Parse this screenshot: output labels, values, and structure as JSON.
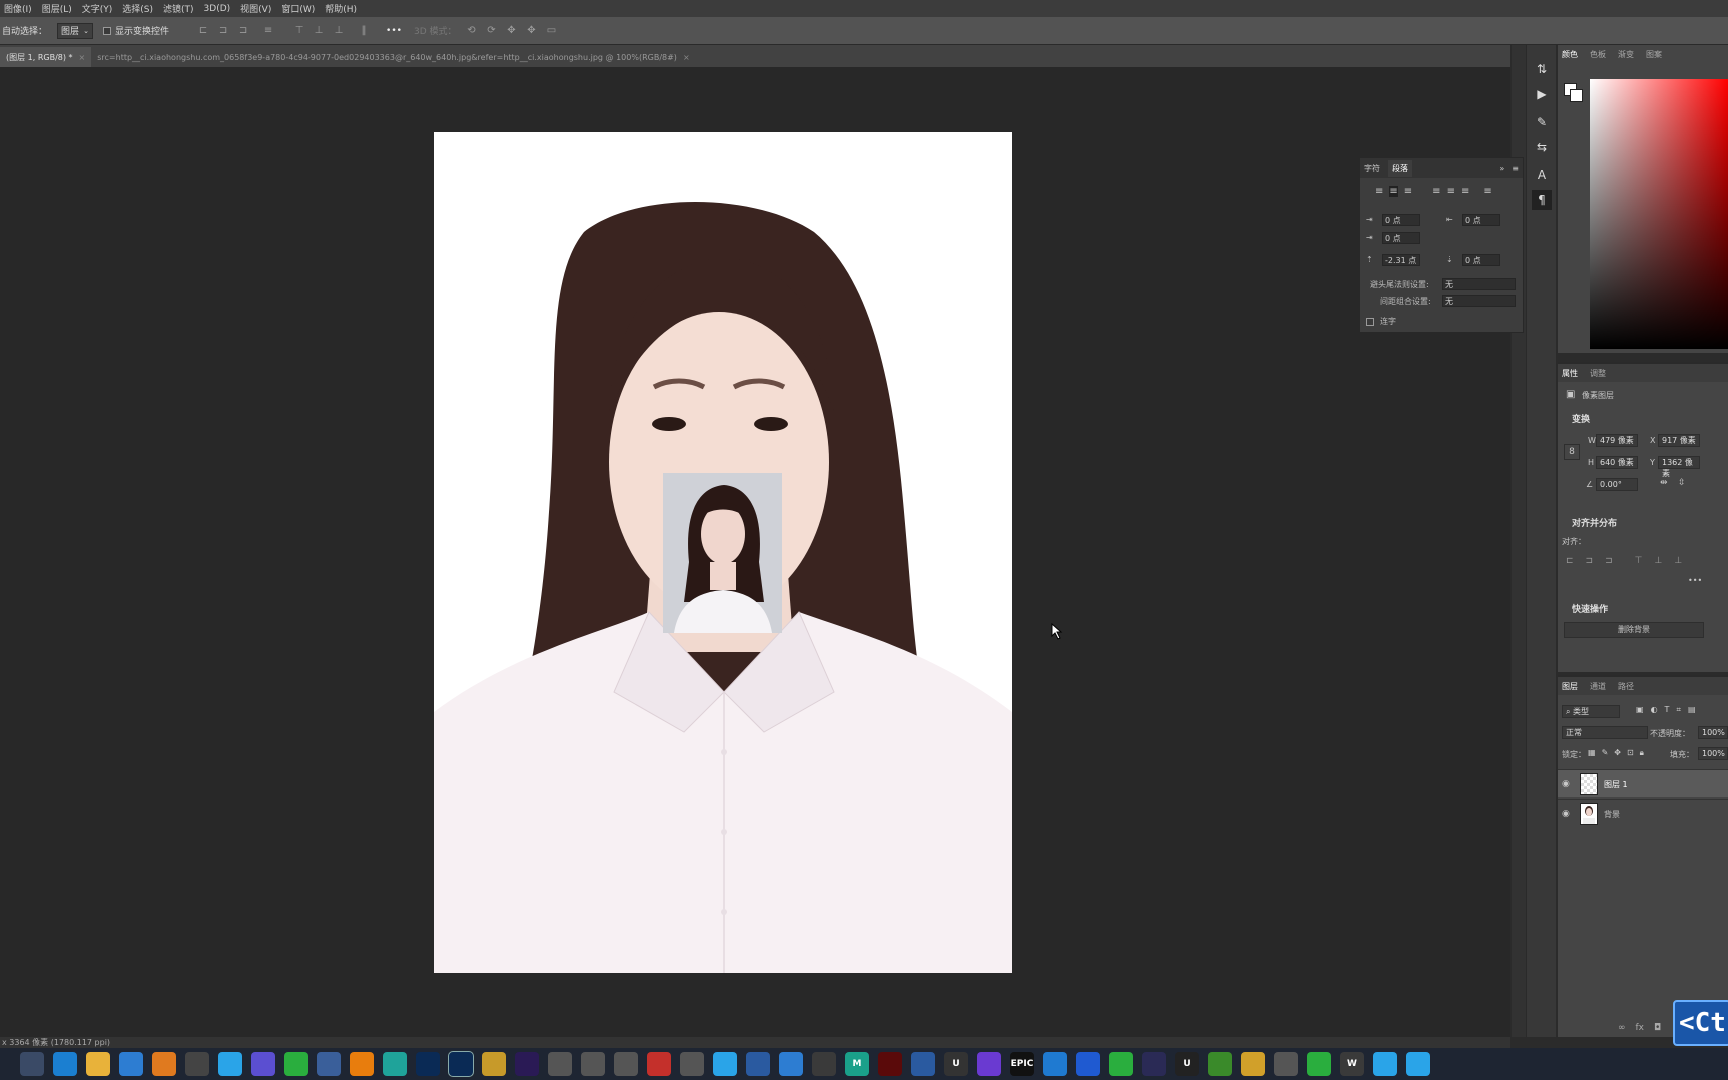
{
  "menu": [
    "图像(I)",
    "图层(L)",
    "文字(Y)",
    "选择(S)",
    "滤镜(T)",
    "3D(D)",
    "视图(V)",
    "窗口(W)",
    "帮助(H)"
  ],
  "options": {
    "auto_select_label": "自动选择：",
    "auto_select_value": "图层",
    "show_transform_label": "显示变换控件",
    "mode_label": "3D 模式：",
    "more": "•••"
  },
  "tabs": [
    {
      "label": "(图层 1, RGB/8) *"
    },
    {
      "label": "src=http__ci.xiaohongshu.com_0658f3e9-a780-4c94-9077-0ed029403363@r_640w_640h.jpg&refer=http__ci.xiaohongshu.jpg @ 100%(RGB/8#)"
    }
  ],
  "paragraph_panel": {
    "tab_char": "字符",
    "tab_para": "段落",
    "indent_left": "0 点",
    "indent_right": "0 点",
    "indent_first": "0 点",
    "space_before": "-2.31 点",
    "space_after": "0 点",
    "kinsoku_label": "避头尾法则设置:",
    "kinsoku_value": "无",
    "mojikumi_label": "间距组合设置:",
    "mojikumi_value": "无",
    "hyphen_label": "连字"
  },
  "color_panel": {
    "tabs": [
      "颜色",
      "色板",
      "渐变",
      "图案"
    ]
  },
  "properties": {
    "tabs": [
      "属性",
      "调整"
    ],
    "layer_type": "像素图层",
    "transform_title": "变换",
    "w": "479 像素",
    "h": "640 像素",
    "x": "917 像素",
    "y": "1362 像素",
    "w_label": "W",
    "h_label": "H",
    "x_label": "X",
    "y_label": "Y",
    "angle": "0.00°",
    "align_title": "对齐并分布",
    "align_label": "对齐：",
    "quick_title": "快速操作",
    "remove_bg": "删除背景",
    "more": "•••"
  },
  "layers": {
    "tabs": [
      "图层",
      "通道",
      "路径"
    ],
    "filter": "类型",
    "blend": "正常",
    "opacity_label": "不透明度：",
    "opacity": "100%",
    "lock_label": "锁定：",
    "fill_label": "填充：",
    "fill": "100%",
    "items": [
      {
        "name": "图层 1",
        "selected": true
      },
      {
        "name": "背景",
        "selected": false
      }
    ]
  },
  "status": "x 3364 像素 (1780.117 ppi)",
  "shortcut_overlay": "<Ct",
  "taskbar_apps": [
    "start",
    "edge",
    "explorer",
    "app-blue",
    "app-orange",
    "app-dark",
    "app-bird",
    "app-three",
    "wechat",
    "app-s",
    "blender",
    "app-3",
    "Ps",
    "Ps",
    "app-ball",
    "Ae",
    "app-t",
    "app-t2",
    "app-ct",
    "app-red",
    "app-uv",
    "app-cube",
    "app-gear",
    "app-circle",
    "app-davinci",
    "M",
    "An",
    "app-globe",
    "U",
    "github",
    "EPIC",
    "app-f",
    "app-wave",
    "app-green",
    "app-c4d",
    "U",
    "nvidia",
    "app-pal",
    "app-tri",
    "app-mail",
    "W",
    "app-img",
    "app-note"
  ]
}
